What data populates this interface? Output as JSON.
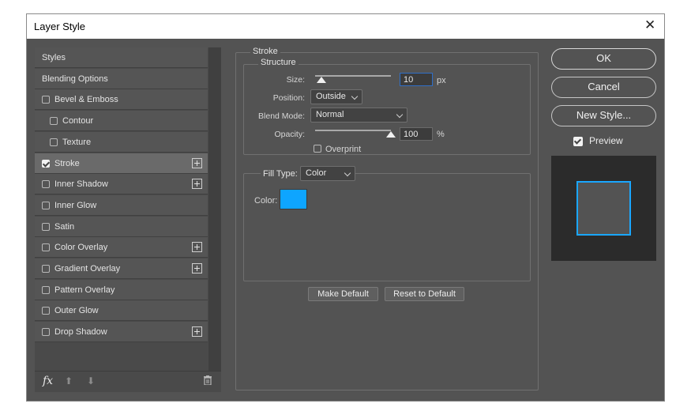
{
  "window": {
    "title": "Layer Style"
  },
  "styles_list": [
    {
      "label": "Styles",
      "checkbox": false,
      "indent": 0,
      "plus": false
    },
    {
      "label": "Blending Options",
      "checkbox": false,
      "indent": 0,
      "plus": false
    },
    {
      "label": "Bevel & Emboss",
      "checkbox": true,
      "checked": false,
      "indent": 0,
      "plus": false
    },
    {
      "label": "Contour",
      "checkbox": true,
      "checked": false,
      "indent": 1,
      "plus": false
    },
    {
      "label": "Texture",
      "checkbox": true,
      "checked": false,
      "indent": 1,
      "plus": false
    },
    {
      "label": "Stroke",
      "checkbox": true,
      "checked": true,
      "indent": 0,
      "plus": true,
      "selected": true
    },
    {
      "label": "Inner Shadow",
      "checkbox": true,
      "checked": false,
      "indent": 0,
      "plus": true
    },
    {
      "label": "Inner Glow",
      "checkbox": true,
      "checked": false,
      "indent": 0,
      "plus": false
    },
    {
      "label": "Satin",
      "checkbox": true,
      "checked": false,
      "indent": 0,
      "plus": false
    },
    {
      "label": "Color Overlay",
      "checkbox": true,
      "checked": false,
      "indent": 0,
      "plus": true
    },
    {
      "label": "Gradient Overlay",
      "checkbox": true,
      "checked": false,
      "indent": 0,
      "plus": true
    },
    {
      "label": "Pattern Overlay",
      "checkbox": true,
      "checked": false,
      "indent": 0,
      "plus": false
    },
    {
      "label": "Outer Glow",
      "checkbox": true,
      "checked": false,
      "indent": 0,
      "plus": false
    },
    {
      "label": "Drop Shadow",
      "checkbox": true,
      "checked": false,
      "indent": 0,
      "plus": true
    }
  ],
  "footer_icons": {
    "fx": "fx",
    "up": "arrow-up-icon",
    "down": "arrow-down-icon",
    "trash": "trash-icon"
  },
  "stroke": {
    "section_title": "Stroke",
    "structure_title": "Structure",
    "size_label": "Size:",
    "size_value": "10",
    "size_unit": "px",
    "size_fraction": 0.08,
    "position_label": "Position:",
    "position_value": "Outside",
    "blend_label": "Blend Mode:",
    "blend_value": "Normal",
    "opacity_label": "Opacity:",
    "opacity_value": "100",
    "opacity_unit": "%",
    "opacity_fraction": 1.0,
    "overprint_label": "Overprint",
    "overprint_checked": false,
    "fill_type_label": "Fill Type:",
    "fill_type_value": "Color",
    "color_label": "Color:",
    "color_value": "#0ea5ff"
  },
  "buttons": {
    "make_default": "Make Default",
    "reset_default": "Reset to Default",
    "ok": "OK",
    "cancel": "Cancel",
    "new_style": "New Style...",
    "preview_label": "Preview",
    "preview_checked": true
  },
  "preview": {
    "stroke_color": "#1aa7ff"
  }
}
